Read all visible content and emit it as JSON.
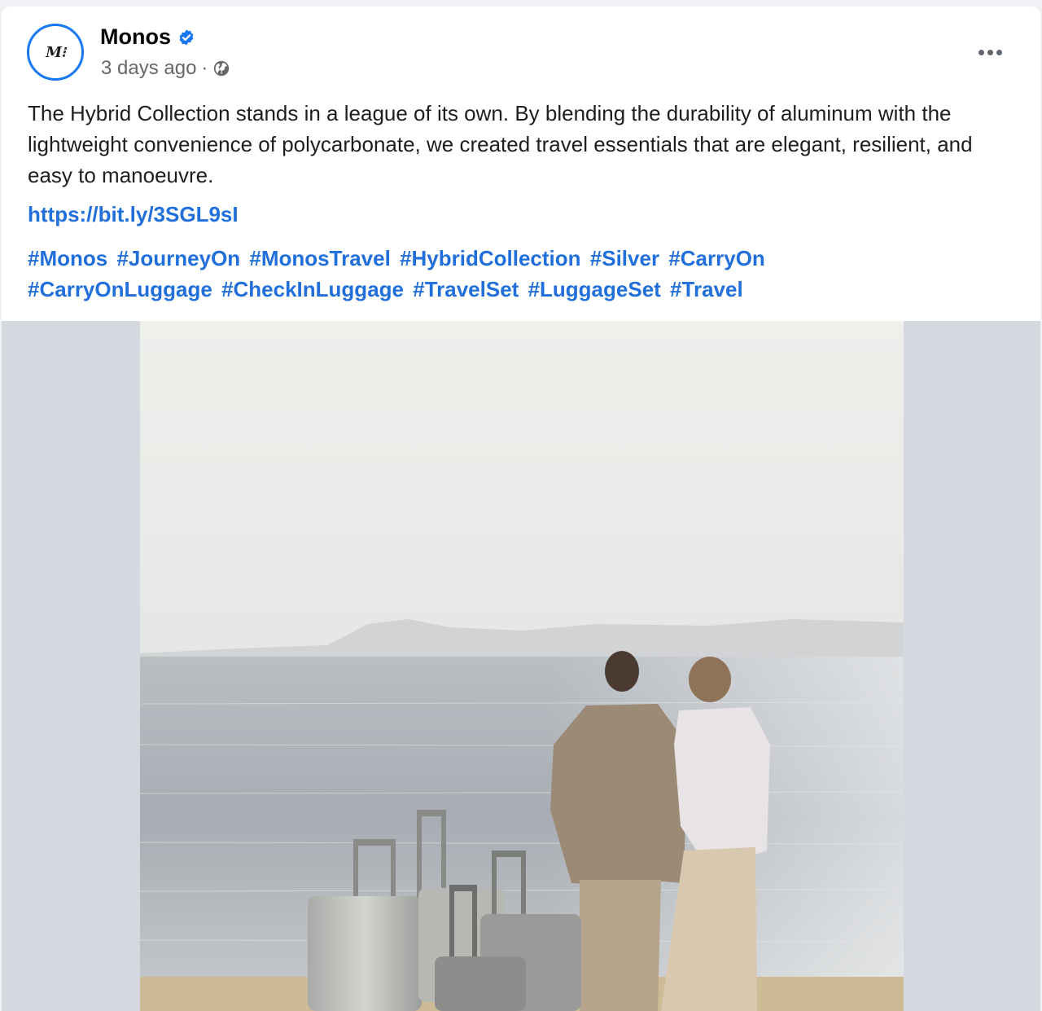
{
  "post": {
    "page_name": "Monos",
    "avatar_text": "M⁝",
    "timestamp": "3 days ago",
    "separator": "·",
    "body": "The Hybrid Collection stands in a league of its own. By blending the durability of aluminum with the lightweight convenience of polycarbonate, we created travel essentials that are elegant, resilient, and easy to manoeuvre.",
    "link": "https://bit.ly/3SGL9sI",
    "hashtags": [
      "#Monos",
      "#JourneyOn",
      "#MonosTravel",
      "#HybridCollection",
      "#Silver",
      "#CarryOn",
      "#CarryOnLuggage",
      "#CheckInLuggage",
      "#TravelSet",
      "#LuggageSet",
      "#Travel"
    ]
  },
  "icons": {
    "verified": "verified-badge-icon",
    "audience": "globe-icon",
    "more": "more-options-icon"
  },
  "colors": {
    "accent": "#1877f2",
    "link": "#216fdb",
    "meta": "#65676b",
    "media_backdrop": "#d3d9de"
  }
}
